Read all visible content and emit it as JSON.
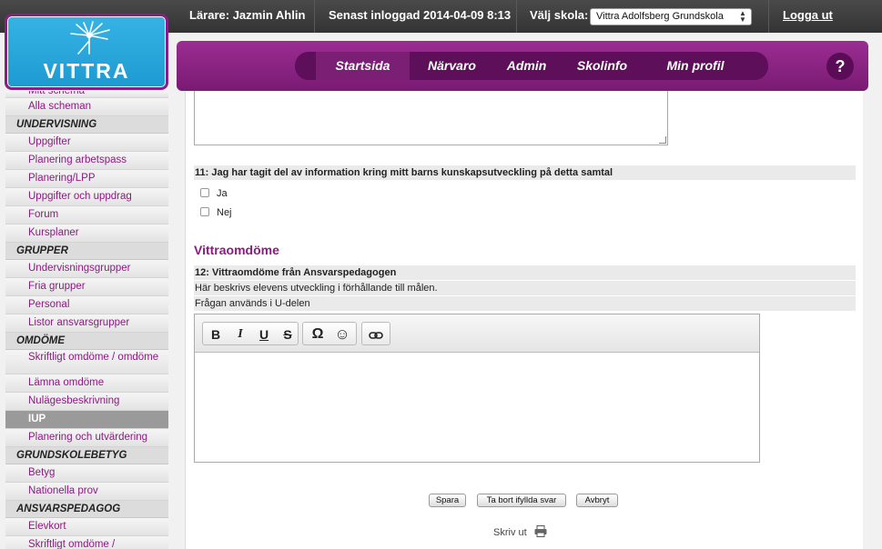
{
  "topbar": {
    "teacher": "Lärare: Jazmin Ahlin",
    "last_login": "Senast inloggad 2014-04-09 8:13",
    "school_label": "Välj skola:",
    "school_value": "Vittra Adolfsberg Grundskola",
    "logout": "Logga ut"
  },
  "logo": {
    "text": "VITTRA"
  },
  "nav": {
    "tabs": [
      {
        "label": "Startsida"
      },
      {
        "label": "Närvaro"
      },
      {
        "label": "Admin"
      },
      {
        "label": "Skolinfo"
      },
      {
        "label": "Min profil"
      }
    ],
    "help": "?"
  },
  "sidebar": {
    "partial_top": "Mitt schema",
    "alla_scheman": "Alla scheman",
    "undervisning": "UNDERVISNING",
    "uppgifter": "Uppgifter",
    "planering_arbetspass": "Planering arbetspass",
    "planering_lpp": "Planering/LPP",
    "uppgifter_uppdrag": "Uppgifter och uppdrag",
    "forum": "Forum",
    "kursplaner": "Kursplaner",
    "grupper": "GRUPPER",
    "undervisningsgrupper": "Undervisningsgrupper",
    "fria_grupper": "Fria grupper",
    "personal": "Personal",
    "listor": "Listor ansvarsgrupper",
    "omdome": "OMDÖME",
    "skriftligt": "Skriftligt omdöme / omdöme",
    "lamna": "Lämna omdöme",
    "nulage": "Nulägesbeskrivning",
    "iup": "IUP",
    "planering_utv": "Planering och utvärdering",
    "grundskolebetyg": "GRUNDSKOLEBETYG",
    "betyg": "Betyg",
    "nationella": "Nationella prov",
    "ansvarspedagog": "ANSVARSPEDAGOG",
    "elevkort": "Elevkort",
    "partial_bottom": "Skriftligt omdöme /"
  },
  "main": {
    "q11": {
      "number": "11:",
      "text": "Jag har tagit del av information kring mitt barns kunskapsutveckling på detta samtal"
    },
    "opt_yes": "Ja",
    "opt_no": "Nej",
    "section": "Vittraomdöme",
    "q12": {
      "number": "12:",
      "text": "Vittraomdöme från Ansvarspedagogen"
    },
    "q12_desc": "Här beskrivs elevens utveckling i förhållande till målen.",
    "q12_note": "Frågan används i U-delen",
    "toolbar": {
      "bold": "B",
      "italic": "I",
      "underline": "U",
      "strike": "S",
      "omega": "Ω",
      "smiley": "☺"
    },
    "buttons": {
      "save": "Spara",
      "remove": "Ta bort ifyllda svar",
      "cancel": "Avbryt"
    },
    "print": "Skriv ut"
  }
}
